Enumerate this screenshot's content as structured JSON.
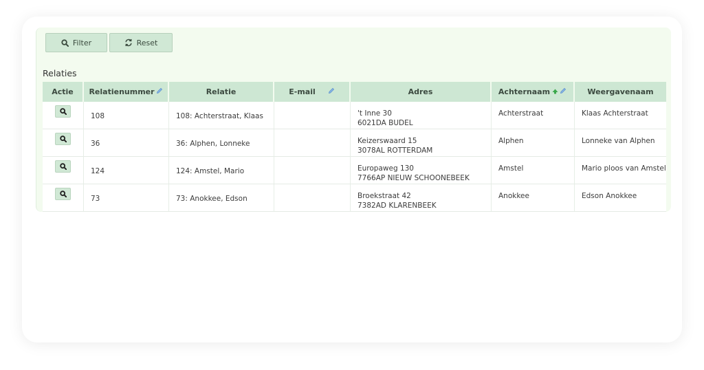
{
  "toolbar": {
    "filter_label": "Filter",
    "reset_label": "Reset"
  },
  "section_title": "Relaties",
  "table": {
    "columns": {
      "actie": "Actie",
      "relatienummer": "Relatienummer",
      "relatie": "Relatie",
      "email": "E-mail",
      "adres": "Adres",
      "achternaam": "Achternaam",
      "weergavenaam": "Weergavenaam"
    },
    "rows": [
      {
        "relatienummer": "108",
        "relatie": "108: Achterstraat, Klaas",
        "email": "",
        "adres_line1": "'t Inne 30",
        "adres_line2": "6021DA BUDEL",
        "achternaam": "Achterstraat",
        "weergavenaam": "Klaas Achterstraat"
      },
      {
        "relatienummer": "36",
        "relatie": "36: Alphen, Lonneke",
        "email": "",
        "adres_line1": "Keizerswaard 15",
        "adres_line2": "3078AL ROTTERDAM",
        "achternaam": "Alphen",
        "weergavenaam": "Lonneke van Alphen"
      },
      {
        "relatienummer": "124",
        "relatie": "124: Amstel, Mario",
        "email": "",
        "adres_line1": "Europaweg 130",
        "adres_line2": "7766AP NIEUW SCHOONEBEEK",
        "achternaam": "Amstel",
        "weergavenaam": "Mario ploos van Amstel"
      },
      {
        "relatienummer": "73",
        "relatie": "73: Anokkee, Edson",
        "email": "",
        "adres_line1": "Broekstraat 42",
        "adres_line2": "7382AD KLARENBEEK",
        "achternaam": "Anokkee",
        "weergavenaam": "Edson Anokkee"
      }
    ]
  },
  "icons": {
    "filter": "search-icon",
    "reset": "refresh-icon",
    "view": "search-icon",
    "edit_column": "pencil-icon",
    "sort": "sort-ascending-icon"
  },
  "colors": {
    "header_bg": "#cde7d3",
    "button_bg": "#d0e8d5",
    "panel_bg": "#f3fbef",
    "sort_arrow": "#3aa84a",
    "pencil": "#6a9fd8"
  }
}
